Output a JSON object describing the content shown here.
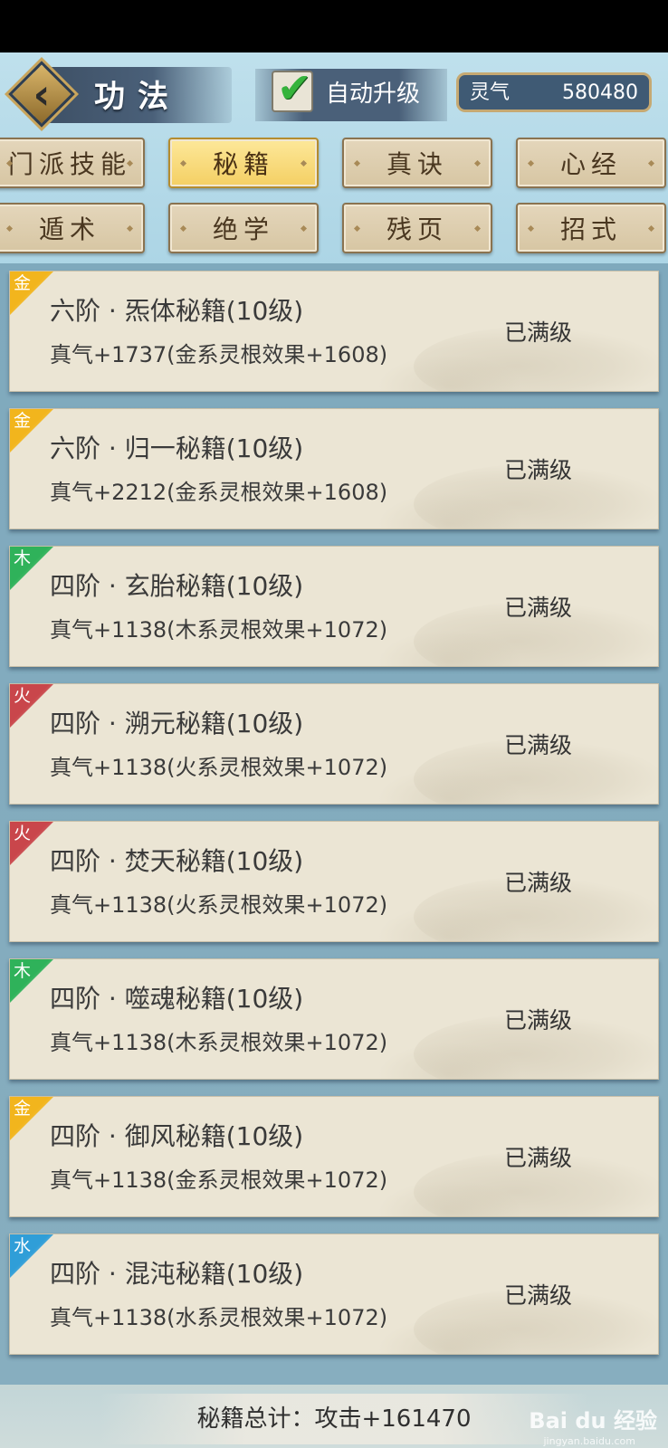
{
  "header": {
    "title": "功法",
    "auto_upgrade_label": "自动升级",
    "auto_upgrade_checked": true,
    "resource_label": "灵气",
    "resource_value": "580480"
  },
  "tabs": [
    {
      "label": "门派技能",
      "active": false
    },
    {
      "label": "秘籍",
      "active": true
    },
    {
      "label": "真诀",
      "active": false
    },
    {
      "label": "心经",
      "active": false
    },
    {
      "label": "遁术",
      "active": false
    },
    {
      "label": "绝学",
      "active": false
    },
    {
      "label": "残页",
      "active": false
    },
    {
      "label": "招式",
      "active": false
    }
  ],
  "elements": {
    "金": "#f2b51d",
    "木": "#2fb25a",
    "火": "#c9464b",
    "水": "#2f9ed8"
  },
  "items": [
    {
      "element": "金",
      "title": "六阶 · 炁体秘籍(10级)",
      "stat": "真气+1737(金系灵根效果+1608)",
      "status": "已满级"
    },
    {
      "element": "金",
      "title": "六阶 · 归一秘籍(10级)",
      "stat": "真气+2212(金系灵根效果+1608)",
      "status": "已满级"
    },
    {
      "element": "木",
      "title": "四阶 · 玄胎秘籍(10级)",
      "stat": "真气+1138(木系灵根效果+1072)",
      "status": "已满级"
    },
    {
      "element": "火",
      "title": "四阶 · 溯元秘籍(10级)",
      "stat": "真气+1138(火系灵根效果+1072)",
      "status": "已满级"
    },
    {
      "element": "火",
      "title": "四阶 · 焚天秘籍(10级)",
      "stat": "真气+1138(火系灵根效果+1072)",
      "status": "已满级"
    },
    {
      "element": "木",
      "title": "四阶 · 噬魂秘籍(10级)",
      "stat": "真气+1138(木系灵根效果+1072)",
      "status": "已满级"
    },
    {
      "element": "金",
      "title": "四阶 · 御风秘籍(10级)",
      "stat": "真气+1138(金系灵根效果+1072)",
      "status": "已满级"
    },
    {
      "element": "水",
      "title": "四阶 · 混沌秘籍(10级)",
      "stat": "真气+1138(水系灵根效果+1072)",
      "status": "已满级"
    }
  ],
  "footer": {
    "summary": "秘籍总计：攻击+161470"
  },
  "watermark": {
    "text": "Bai du 经验",
    "url": "jingyan.baidu.com"
  }
}
